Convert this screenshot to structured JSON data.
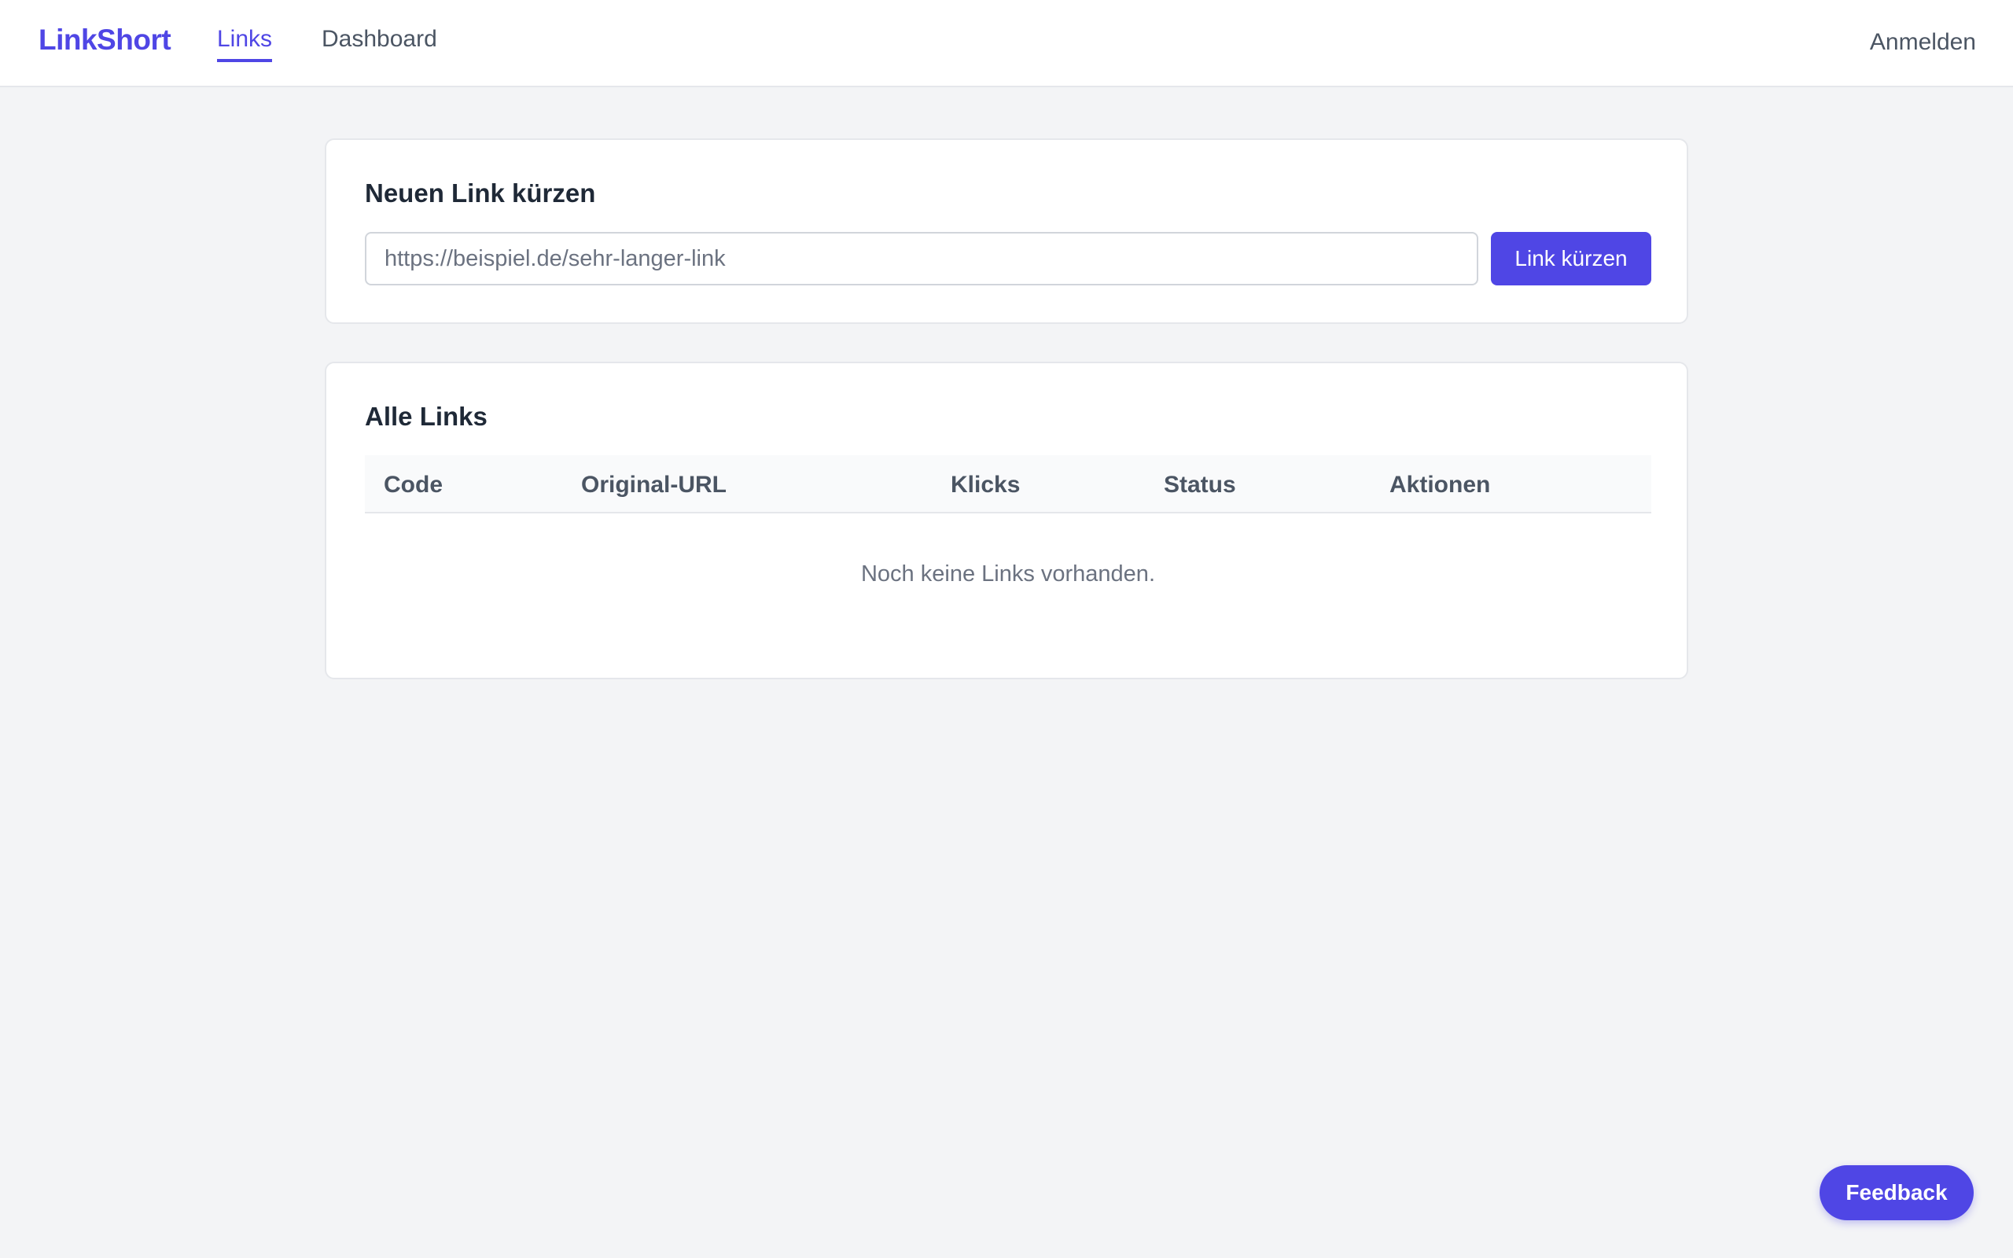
{
  "header": {
    "brand": "LinkShort",
    "nav": [
      {
        "label": "Links",
        "active": true
      },
      {
        "label": "Dashboard",
        "active": false
      }
    ],
    "login_label": "Anmelden"
  },
  "shorten": {
    "title": "Neuen Link kürzen",
    "placeholder": "https://beispiel.de/sehr-langer-link",
    "value": "",
    "button_label": "Link kürzen"
  },
  "links": {
    "title": "Alle Links",
    "columns": [
      "Code",
      "Original-URL",
      "Klicks",
      "Status",
      "Aktionen"
    ],
    "rows": [],
    "empty_message": "Noch keine Links vorhanden."
  },
  "feedback_label": "Feedback",
  "colors": {
    "accent": "#4f46e5",
    "background": "#f3f4f6"
  }
}
